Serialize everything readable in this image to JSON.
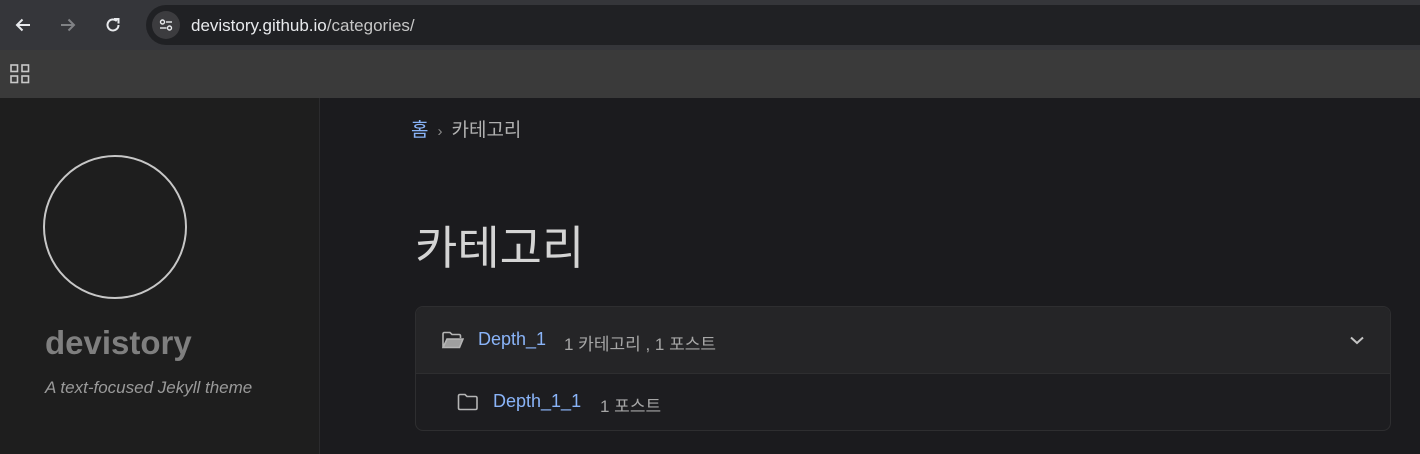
{
  "browser": {
    "url_host": "devistory.github.io",
    "url_path": "/categories/"
  },
  "icons": {
    "back": "arrow-left-icon",
    "forward": "arrow-right-icon",
    "reload": "reload-icon",
    "site_info": "tune-icon",
    "apps": "apps-grid-icon",
    "folder_open": "folder-open-icon",
    "folder": "folder-icon",
    "expand": "chevron-down-icon"
  },
  "sidebar": {
    "title": "devistory",
    "subtitle": "A text-focused Jekyll theme"
  },
  "breadcrumb": {
    "home": "홈",
    "separator": "›",
    "current": "카테고리"
  },
  "page": {
    "title": "카테고리"
  },
  "categories": [
    {
      "name": "Depth_1",
      "meta": "1 카테고리 , 1 포스트",
      "children": [
        {
          "name": "Depth_1_1",
          "meta": "1 포스트"
        }
      ]
    }
  ],
  "colors": {
    "link": "#8ab4f8",
    "background": "#1b1b1e",
    "sidebar": "#1e1e1e"
  }
}
